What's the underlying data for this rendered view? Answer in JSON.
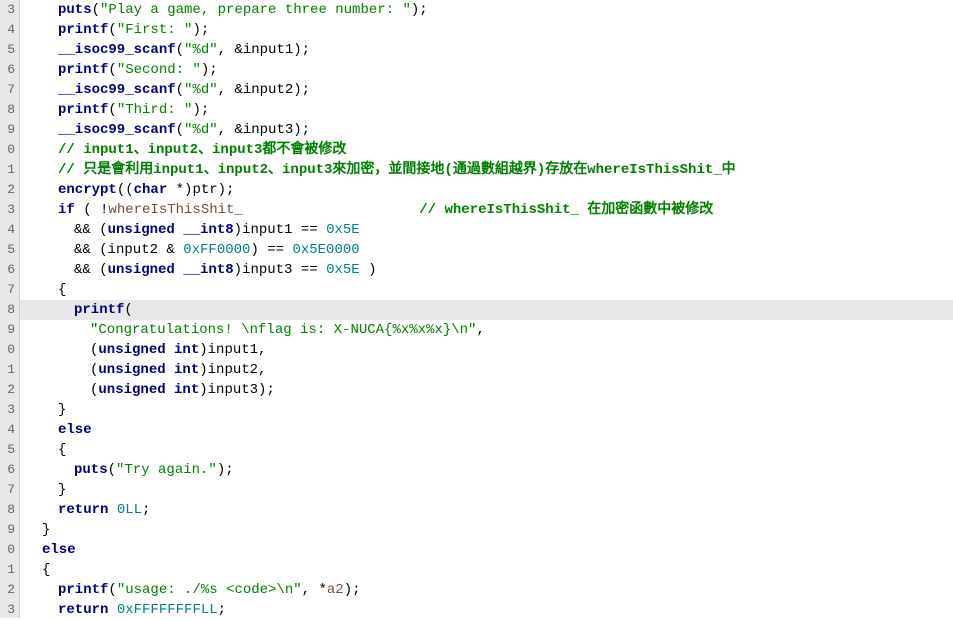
{
  "lines": [
    {
      "n": "3",
      "ind": 38,
      "parts": [
        [
          "blue-bold",
          "puts"
        ],
        [
          "black",
          "("
        ],
        [
          "green",
          "\"Play a game, prepare three number: \""
        ],
        [
          "black",
          ");"
        ]
      ]
    },
    {
      "n": "4",
      "ind": 38,
      "parts": [
        [
          "blue-bold",
          "printf"
        ],
        [
          "black",
          "("
        ],
        [
          "green",
          "\"First: \""
        ],
        [
          "black",
          ");"
        ]
      ]
    },
    {
      "n": "5",
      "ind": 38,
      "parts": [
        [
          "blue-bold",
          "__isoc99_scanf"
        ],
        [
          "black",
          "("
        ],
        [
          "green",
          "\"%d\""
        ],
        [
          "black",
          ", &input1);"
        ]
      ]
    },
    {
      "n": "6",
      "ind": 38,
      "parts": [
        [
          "blue-bold",
          "printf"
        ],
        [
          "black",
          "("
        ],
        [
          "green",
          "\"Second: \""
        ],
        [
          "black",
          ");"
        ]
      ]
    },
    {
      "n": "7",
      "ind": 38,
      "parts": [
        [
          "blue-bold",
          "__isoc99_scanf"
        ],
        [
          "black",
          "("
        ],
        [
          "green",
          "\"%d\""
        ],
        [
          "black",
          ", &input2);"
        ]
      ]
    },
    {
      "n": "8",
      "ind": 38,
      "parts": [
        [
          "blue-bold",
          "printf"
        ],
        [
          "black",
          "("
        ],
        [
          "green",
          "\"Third: \""
        ],
        [
          "black",
          ");"
        ]
      ]
    },
    {
      "n": "9",
      "ind": 38,
      "parts": [
        [
          "blue-bold",
          "__isoc99_scanf"
        ],
        [
          "black",
          "("
        ],
        [
          "green",
          "\"%d\""
        ],
        [
          "black",
          ", &input3);"
        ]
      ]
    },
    {
      "n": "0",
      "ind": 38,
      "parts": [
        [
          "dark-green",
          "// input1、input2、input3都不會被修改"
        ]
      ]
    },
    {
      "n": "1",
      "ind": 38,
      "parts": [
        [
          "dark-green",
          "// 只是會利用input1、input2、input3來加密，並間接地(通過數組越界)存放在whereIsThisShit_中"
        ]
      ]
    },
    {
      "n": "2",
      "ind": 38,
      "parts": [
        [
          "blue-bold",
          "encrypt"
        ],
        [
          "black",
          "(("
        ],
        [
          "blue-bold",
          "char "
        ],
        [
          "black",
          "*)ptr);"
        ]
      ]
    },
    {
      "n": "3",
      "ind": 38,
      "parts": [
        [
          "blue-bold",
          "if"
        ],
        [
          "black",
          " ( !"
        ],
        [
          "brown",
          "whereIsThisShit_"
        ],
        [
          "black",
          "                     "
        ],
        [
          "dark-green",
          "// whereIsThisShit_ 在加密函數中被修改"
        ]
      ]
    },
    {
      "n": "4",
      "ind": 54,
      "parts": [
        [
          "black",
          "&& ("
        ],
        [
          "blue-bold",
          "unsigned __int8"
        ],
        [
          "black",
          ")input1 == "
        ],
        [
          "teal",
          "0x5E"
        ]
      ]
    },
    {
      "n": "5",
      "ind": 54,
      "parts": [
        [
          "black",
          "&& (input2 & "
        ],
        [
          "teal",
          "0xFF0000"
        ],
        [
          "black",
          ") == "
        ],
        [
          "teal",
          "0x5E0000"
        ]
      ]
    },
    {
      "n": "6",
      "ind": 54,
      "parts": [
        [
          "black",
          "&& ("
        ],
        [
          "blue-bold",
          "unsigned __int8"
        ],
        [
          "black",
          ")input3 == "
        ],
        [
          "teal",
          "0x5E"
        ],
        [
          "black",
          " )"
        ]
      ]
    },
    {
      "n": "7",
      "ind": 38,
      "parts": [
        [
          "black",
          "{"
        ]
      ]
    },
    {
      "n": "8",
      "ind": 54,
      "hl": true,
      "parts": [
        [
          "blue-bold",
          "printf"
        ],
        [
          "black",
          "("
        ]
      ]
    },
    {
      "n": "9",
      "ind": 70,
      "parts": [
        [
          "green",
          "\"Congratulations! \\nflag is: X-NUCA{%x%x%x}\\n\""
        ],
        [
          "black",
          ","
        ]
      ]
    },
    {
      "n": "0",
      "ind": 70,
      "parts": [
        [
          "black",
          "("
        ],
        [
          "blue-bold",
          "unsigned int"
        ],
        [
          "black",
          ")input1,"
        ]
      ]
    },
    {
      "n": "1",
      "ind": 70,
      "parts": [
        [
          "black",
          "("
        ],
        [
          "blue-bold",
          "unsigned int"
        ],
        [
          "black",
          ")input2,"
        ]
      ]
    },
    {
      "n": "2",
      "ind": 70,
      "parts": [
        [
          "black",
          "("
        ],
        [
          "blue-bold",
          "unsigned int"
        ],
        [
          "black",
          ")input3);"
        ]
      ]
    },
    {
      "n": "3",
      "ind": 38,
      "parts": [
        [
          "black",
          "}"
        ]
      ]
    },
    {
      "n": "4",
      "ind": 38,
      "parts": [
        [
          "blue-bold",
          "else"
        ]
      ]
    },
    {
      "n": "5",
      "ind": 38,
      "parts": [
        [
          "black",
          "{"
        ]
      ]
    },
    {
      "n": "6",
      "ind": 54,
      "parts": [
        [
          "blue-bold",
          "puts"
        ],
        [
          "black",
          "("
        ],
        [
          "green",
          "\"Try again.\""
        ],
        [
          "black",
          ");"
        ]
      ]
    },
    {
      "n": "7",
      "ind": 38,
      "parts": [
        [
          "black",
          "}"
        ]
      ]
    },
    {
      "n": "8",
      "ind": 38,
      "parts": [
        [
          "blue-bold",
          "return"
        ],
        [
          "black",
          " "
        ],
        [
          "teal",
          "0LL"
        ],
        [
          "black",
          ";"
        ]
      ]
    },
    {
      "n": "9",
      "ind": 22,
      "parts": [
        [
          "black",
          "}"
        ]
      ]
    },
    {
      "n": "0",
      "ind": 22,
      "parts": [
        [
          "blue-bold",
          "else"
        ]
      ]
    },
    {
      "n": "1",
      "ind": 22,
      "parts": [
        [
          "black",
          "{"
        ]
      ]
    },
    {
      "n": "2",
      "ind": 38,
      "parts": [
        [
          "blue-bold",
          "printf"
        ],
        [
          "black",
          "("
        ],
        [
          "green",
          "\"usage: ./%s <code>\\n\""
        ],
        [
          "black",
          ", *"
        ],
        [
          "brown",
          "a2"
        ],
        [
          "black",
          ");"
        ]
      ]
    },
    {
      "n": "3",
      "ind": 38,
      "parts": [
        [
          "blue-bold",
          "return"
        ],
        [
          "black",
          " "
        ],
        [
          "teal",
          "0xFFFFFFFFLL"
        ],
        [
          "black",
          ";"
        ]
      ]
    }
  ]
}
